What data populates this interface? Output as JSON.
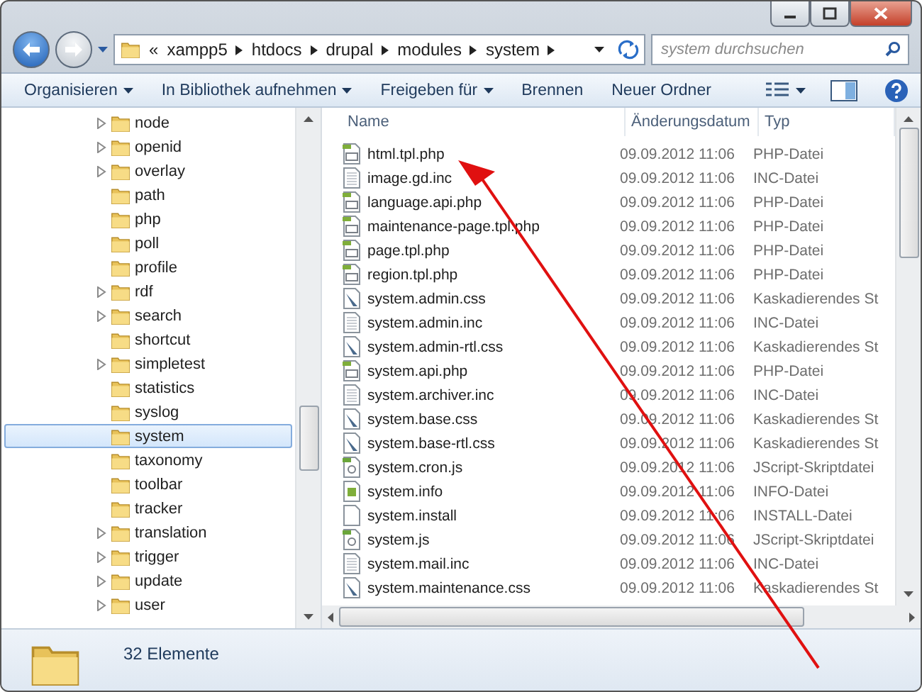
{
  "address": {
    "overflow": "«",
    "crumbs": [
      "xampp5",
      "htdocs",
      "drupal",
      "modules",
      "system"
    ]
  },
  "search": {
    "placeholder": "system durchsuchen"
  },
  "toolbar": [
    {
      "label": "Organisieren",
      "dropdown": true
    },
    {
      "label": "In Bibliothek aufnehmen",
      "dropdown": true
    },
    {
      "label": "Freigeben für",
      "dropdown": true
    },
    {
      "label": "Brennen",
      "dropdown": false
    },
    {
      "label": "Neuer Ordner",
      "dropdown": false
    }
  ],
  "tree": [
    {
      "label": "node",
      "expandable": true,
      "selected": false
    },
    {
      "label": "openid",
      "expandable": true,
      "selected": false
    },
    {
      "label": "overlay",
      "expandable": true,
      "selected": false
    },
    {
      "label": "path",
      "expandable": false,
      "selected": false
    },
    {
      "label": "php",
      "expandable": false,
      "selected": false
    },
    {
      "label": "poll",
      "expandable": false,
      "selected": false
    },
    {
      "label": "profile",
      "expandable": false,
      "selected": false
    },
    {
      "label": "rdf",
      "expandable": true,
      "selected": false
    },
    {
      "label": "search",
      "expandable": true,
      "selected": false
    },
    {
      "label": "shortcut",
      "expandable": false,
      "selected": false
    },
    {
      "label": "simpletest",
      "expandable": true,
      "selected": false
    },
    {
      "label": "statistics",
      "expandable": false,
      "selected": false
    },
    {
      "label": "syslog",
      "expandable": false,
      "selected": false
    },
    {
      "label": "system",
      "expandable": false,
      "selected": true
    },
    {
      "label": "taxonomy",
      "expandable": false,
      "selected": false
    },
    {
      "label": "toolbar",
      "expandable": false,
      "selected": false
    },
    {
      "label": "tracker",
      "expandable": false,
      "selected": false
    },
    {
      "label": "translation",
      "expandable": true,
      "selected": false
    },
    {
      "label": "trigger",
      "expandable": true,
      "selected": false
    },
    {
      "label": "update",
      "expandable": true,
      "selected": false
    },
    {
      "label": "user",
      "expandable": true,
      "selected": false
    }
  ],
  "table": {
    "columns": [
      "Name",
      "Änderungsdatum",
      "Typ"
    ],
    "rows": [
      {
        "kind": "php",
        "name": "html.tpl.php",
        "date": "09.09.2012 11:06",
        "type": "PHP-Datei"
      },
      {
        "kind": "inc",
        "name": "image.gd.inc",
        "date": "09.09.2012 11:06",
        "type": "INC-Datei"
      },
      {
        "kind": "php",
        "name": "language.api.php",
        "date": "09.09.2012 11:06",
        "type": "PHP-Datei"
      },
      {
        "kind": "php",
        "name": "maintenance-page.tpl.php",
        "date": "09.09.2012 11:06",
        "type": "PHP-Datei"
      },
      {
        "kind": "php",
        "name": "page.tpl.php",
        "date": "09.09.2012 11:06",
        "type": "PHP-Datei"
      },
      {
        "kind": "php",
        "name": "region.tpl.php",
        "date": "09.09.2012 11:06",
        "type": "PHP-Datei"
      },
      {
        "kind": "css",
        "name": "system.admin.css",
        "date": "09.09.2012 11:06",
        "type": "Kaskadierendes St"
      },
      {
        "kind": "inc",
        "name": "system.admin.inc",
        "date": "09.09.2012 11:06",
        "type": "INC-Datei"
      },
      {
        "kind": "css",
        "name": "system.admin-rtl.css",
        "date": "09.09.2012 11:06",
        "type": "Kaskadierendes St"
      },
      {
        "kind": "php",
        "name": "system.api.php",
        "date": "09.09.2012 11:06",
        "type": "PHP-Datei"
      },
      {
        "kind": "inc",
        "name": "system.archiver.inc",
        "date": "09.09.2012 11:06",
        "type": "INC-Datei"
      },
      {
        "kind": "css",
        "name": "system.base.css",
        "date": "09.09.2012 11:06",
        "type": "Kaskadierendes St"
      },
      {
        "kind": "css",
        "name": "system.base-rtl.css",
        "date": "09.09.2012 11:06",
        "type": "Kaskadierendes St"
      },
      {
        "kind": "js",
        "name": "system.cron.js",
        "date": "09.09.2012 11:06",
        "type": "JScript-Skriptdatei"
      },
      {
        "kind": "info",
        "name": "system.info",
        "date": "09.09.2012 11:06",
        "type": "INFO-Datei"
      },
      {
        "kind": "install",
        "name": "system.install",
        "date": "09.09.2012 11:06",
        "type": "INSTALL-Datei"
      },
      {
        "kind": "js",
        "name": "system.js",
        "date": "09.09.2012 11:06",
        "type": "JScript-Skriptdatei"
      },
      {
        "kind": "inc",
        "name": "system.mail.inc",
        "date": "09.09.2012 11:06",
        "type": "INC-Datei"
      },
      {
        "kind": "css",
        "name": "system.maintenance.css",
        "date": "09.09.2012 11:06",
        "type": "Kaskadierendes St"
      }
    ]
  },
  "status_bar": {
    "count": "32 Elemente"
  }
}
